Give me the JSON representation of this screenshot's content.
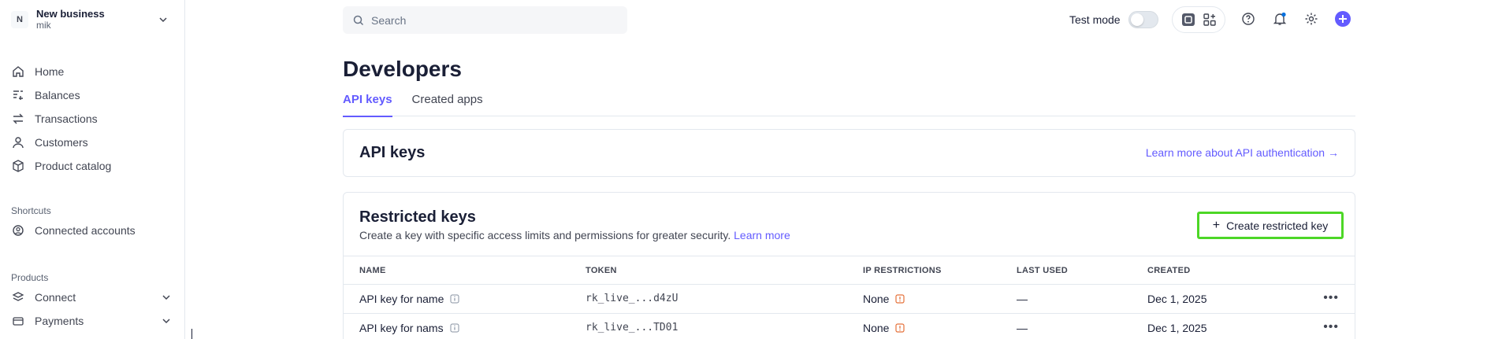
{
  "business": {
    "initial": "N",
    "name": "New business",
    "user": "mik"
  },
  "nav": [
    {
      "label": "Home",
      "icon": "home-icon"
    },
    {
      "label": "Balances",
      "icon": "balances-icon"
    },
    {
      "label": "Transactions",
      "icon": "transactions-icon"
    },
    {
      "label": "Customers",
      "icon": "customer-icon"
    },
    {
      "label": "Product catalog",
      "icon": "product-icon"
    }
  ],
  "shortcuts": {
    "label": "Shortcuts",
    "items": [
      {
        "label": "Connected accounts",
        "icon": "connected-icon"
      }
    ]
  },
  "products": {
    "label": "Products",
    "items": [
      {
        "label": "Connect",
        "icon": "connect-icon"
      },
      {
        "label": "Payments",
        "icon": "payments-icon"
      }
    ]
  },
  "search": {
    "placeholder": "Search"
  },
  "topbar": {
    "test_mode_label": "Test mode",
    "test_mode_on": false
  },
  "page": {
    "title": "Developers",
    "tabs": [
      {
        "label": "API keys",
        "active": true
      },
      {
        "label": "Created apps",
        "active": false
      }
    ]
  },
  "api_keys_card": {
    "title": "API keys",
    "link": "Learn more about API authentication →"
  },
  "restricted_card": {
    "title": "Restricted keys",
    "description": "Create a key with specific access limits and permissions for greater security.",
    "learn_more": "Learn more",
    "create_button": "Create restricted key",
    "columns": [
      "NAME",
      "TOKEN",
      "IP RESTRICTIONS",
      "LAST USED",
      "CREATED"
    ],
    "rows": [
      {
        "name": "API key for name",
        "token": "rk_live_...d4zU",
        "ip": "None",
        "last_used": "—",
        "created": "Dec 1, 2025"
      },
      {
        "name": "API key for nams",
        "token": "rk_live_...TD01",
        "ip": "None",
        "last_used": "—",
        "created": "Dec 1, 2025"
      }
    ]
  },
  "colors": {
    "accent": "#635bff",
    "highlight": "#4dd726",
    "warning": "#e5713a",
    "notification": "#0570de"
  }
}
